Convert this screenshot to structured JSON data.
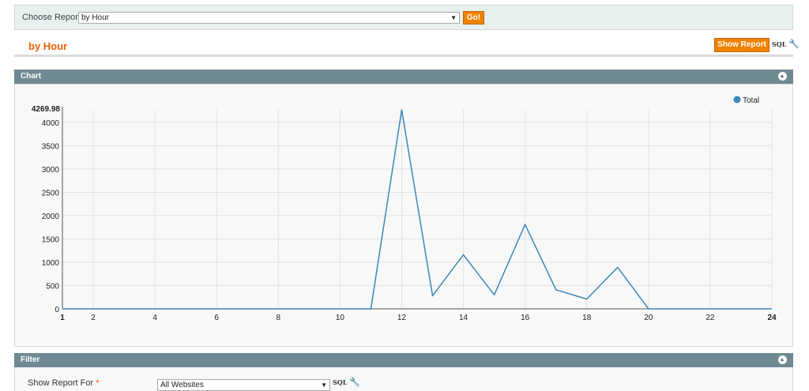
{
  "report_bar": {
    "label": "Choose Report:",
    "selected": "by Hour",
    "go_label": "Go!"
  },
  "page": {
    "title": "by Hour",
    "show_report_label": "Show Report",
    "sql_label": "SQL"
  },
  "chart_section": {
    "title": "Chart"
  },
  "filter_section": {
    "title": "Filter",
    "show_report_for_label": "Show Report For",
    "required_marker": "*",
    "website_value": "All Websites",
    "sql_label": "SQL"
  },
  "icons": {
    "dropdown": "▼",
    "wrench": "wrench-icon",
    "collapse": "collapse-up-icon"
  },
  "colors": {
    "accent": "#eb5e00",
    "button": "#f18200",
    "section_header": "#6f8992",
    "series": "#3a87b9"
  },
  "chart_data": {
    "type": "line",
    "x": [
      1,
      2,
      3,
      4,
      5,
      6,
      7,
      8,
      9,
      10,
      11,
      12,
      13,
      14,
      15,
      16,
      17,
      18,
      19,
      20,
      21,
      22,
      23,
      24
    ],
    "x_ticks": [
      "1",
      "2",
      "4",
      "6",
      "8",
      "10",
      "12",
      "14",
      "16",
      "18",
      "20",
      "22",
      "24"
    ],
    "y_ticks": [
      "0",
      "500",
      "1000",
      "1500",
      "2000",
      "2500",
      "3000",
      "3500",
      "4000"
    ],
    "y_max_label": "4269.98",
    "ylim": [
      0,
      4269.98
    ],
    "grid": true,
    "legend": "top-right",
    "series": [
      {
        "name": "Total",
        "values": [
          0,
          0,
          0,
          0,
          0,
          0,
          0,
          0,
          0,
          0,
          0,
          4269.98,
          280,
          1160,
          300,
          1810,
          410,
          210,
          890,
          0,
          0,
          0,
          0,
          0
        ]
      }
    ]
  }
}
